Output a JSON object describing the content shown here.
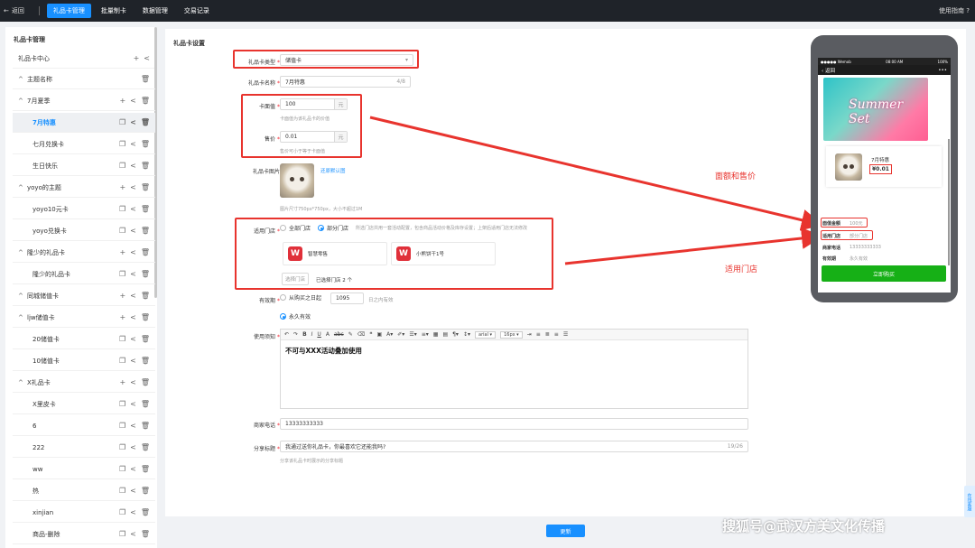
{
  "topbar": {
    "back": "返回",
    "tabs": [
      "礼品卡管理",
      "批量制卡",
      "数据管理",
      "交易记录"
    ],
    "guide": "使用指南"
  },
  "sidebar": {
    "title": "礼品卡管理",
    "root": "礼品卡中心",
    "items": [
      {
        "label": "主题名称",
        "level": 1
      },
      {
        "label": "7月夏季",
        "level": 1,
        "group": true
      },
      {
        "label": "7月特惠",
        "level": 2,
        "active": true
      },
      {
        "label": "七月兑换卡",
        "level": 2
      },
      {
        "label": "生日快乐",
        "level": 2
      },
      {
        "label": "yoyo的主题",
        "level": 1,
        "group": true
      },
      {
        "label": "yoyo10元卡",
        "level": 2
      },
      {
        "label": "yoyo兑换卡",
        "level": 2
      },
      {
        "label": "隆少的礼品卡",
        "level": 1,
        "group": true
      },
      {
        "label": "隆少的礼品卡",
        "level": 2
      },
      {
        "label": "同城储值卡",
        "level": 1,
        "group": true
      },
      {
        "label": "ljw储值卡",
        "level": 1,
        "group": true
      },
      {
        "label": "20储值卡",
        "level": 2
      },
      {
        "label": "10储值卡",
        "level": 2
      },
      {
        "label": "X礼品卡",
        "level": 1,
        "group": true
      },
      {
        "label": "X里皮卡",
        "level": 2
      },
      {
        "label": "6",
        "level": 2
      },
      {
        "label": "222",
        "level": 2
      },
      {
        "label": "ww",
        "level": 2
      },
      {
        "label": "热",
        "level": 2
      },
      {
        "label": "xinjian",
        "level": 2
      },
      {
        "label": "商品-删除",
        "level": 2
      }
    ]
  },
  "form": {
    "section_title": "礼品卡设置",
    "card_type": {
      "label": "礼品卡类型",
      "value": "储值卡"
    },
    "card_name": {
      "label": "礼品卡名称",
      "value": "7月特惠",
      "count": "4/8"
    },
    "face_value": {
      "label": "卡面值",
      "value": "100",
      "unit": "元",
      "hint": "卡面值为该礼品卡的价值"
    },
    "price": {
      "label": "售价",
      "value": "0.01",
      "unit": "元",
      "hint": "售价可小于等于卡面值"
    },
    "card_image": {
      "label": "礼品卡图片",
      "restore": "还原默认图",
      "hint": "图片尺寸750px*750px，大小不超过1M"
    },
    "stores": {
      "label": "适用门店",
      "opt_all": "全部门店",
      "opt_part": "部分门店",
      "desc": "所选门店共用一套活动配置，包含商品活动价格及库存设置；上架后适用门店无法修改",
      "list": [
        "智慧零售",
        "小熊饼干1号"
      ],
      "select_btn": "选择门店",
      "selected_text": "已选择门店 2 个"
    },
    "validity": {
      "label": "有效期",
      "opt1_prefix": "从购买之日起",
      "days": "1095",
      "opt1_suffix": "日之内有效",
      "opt2": "永久有效"
    },
    "notice": {
      "label": "使用须知",
      "font": "arial",
      "size": "16px",
      "content": "不可与XXX活动叠加使用"
    },
    "phone": {
      "label": "商家电话",
      "value": "13333333333"
    },
    "share": {
      "label": "分享标题",
      "value": "我通过送你礼品卡，你最喜欢它还能我吗?",
      "count": "19/26",
      "hint": "分享该礼品卡时展示的分享标题"
    },
    "save": "更新"
  },
  "preview": {
    "status_left": "●●●●● Wemob",
    "status_time": "08:00 AM",
    "status_right": "100%",
    "back": "返回",
    "more": "•••",
    "banner_text": "Summer Set",
    "card_name": "7月特惠",
    "card_price": "¥0.01",
    "rows": [
      {
        "k": "面值金额",
        "v": "100元"
      },
      {
        "k": "适用门店",
        "v": "部分门店"
      },
      {
        "k": "商家电话",
        "v": "13333333333"
      },
      {
        "k": "有效期",
        "v": "永久有效"
      }
    ],
    "buy": "立即购买"
  },
  "annotations": {
    "a1": "面额和售价",
    "a2": "适用门店"
  },
  "side_tab": "在线客服",
  "watermark": "搜狐号@武汉方美文化传播",
  "colors": {
    "accent": "#1890ff",
    "annotation": "#e8342e",
    "buy": "#16b016"
  }
}
